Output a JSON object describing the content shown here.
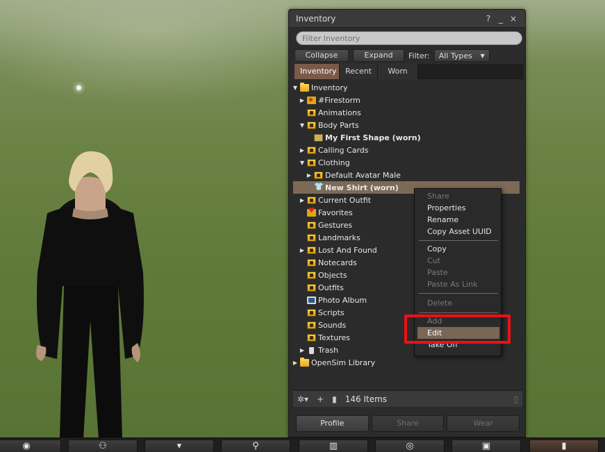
{
  "window": {
    "title": "Inventory",
    "help_label": "?",
    "minimize_label": "_",
    "close_label": "×"
  },
  "filter": {
    "placeholder": "Filter Inventory",
    "collapse_label": "Collapse",
    "expand_label": "Expand",
    "filter_label": "Filter:",
    "type_selected": "All Types"
  },
  "tabs": [
    {
      "label": "Inventory",
      "active": true
    },
    {
      "label": "Recent",
      "active": false
    },
    {
      "label": "Worn",
      "active": false
    }
  ],
  "tree": [
    {
      "label": "Inventory",
      "expanded": true,
      "icon": "folder-icon"
    },
    {
      "label": "#Firestorm",
      "expanded": false,
      "icon": "firestorm-folder-icon"
    },
    {
      "label": "Animations",
      "icon": "animations-folder-icon"
    },
    {
      "label": "Body Parts",
      "expanded": true,
      "icon": "body-parts-folder-icon"
    },
    {
      "label": "My First Shape (worn)",
      "icon": "shape-icon",
      "bold": true
    },
    {
      "label": "Calling Cards",
      "expanded": false,
      "icon": "calling-cards-folder-icon"
    },
    {
      "label": "Clothing",
      "expanded": true,
      "icon": "clothing-folder-icon"
    },
    {
      "label": "Default Avatar Male",
      "expanded": false,
      "icon": "clothing-folder-icon"
    },
    {
      "label": "New Shirt (worn)",
      "icon": "shirt-icon",
      "bold": true,
      "selected": true
    },
    {
      "label": "Current Outfit",
      "expanded": false,
      "icon": "current-outfit-folder-icon"
    },
    {
      "label": "Favorites",
      "icon": "favorites-folder-icon"
    },
    {
      "label": "Gestures",
      "icon": "gestures-folder-icon"
    },
    {
      "label": "Landmarks",
      "icon": "landmarks-folder-icon"
    },
    {
      "label": "Lost And Found",
      "expanded": false,
      "icon": "lost-and-found-folder-icon"
    },
    {
      "label": "Notecards",
      "icon": "notecards-folder-icon"
    },
    {
      "label": "Objects",
      "icon": "objects-folder-icon"
    },
    {
      "label": "Outfits",
      "icon": "outfits-folder-icon"
    },
    {
      "label": "Photo Album",
      "icon": "photo-album-folder-icon"
    },
    {
      "label": "Scripts",
      "icon": "scripts-folder-icon"
    },
    {
      "label": "Sounds",
      "icon": "sounds-folder-icon"
    },
    {
      "label": "Textures",
      "icon": "textures-folder-icon"
    },
    {
      "label": "Trash",
      "expanded": false,
      "icon": "trash-icon"
    },
    {
      "label": "OpenSim Library",
      "expanded": false,
      "icon": "folder-icon"
    }
  ],
  "context_menu": [
    {
      "label": "Share",
      "disabled": true
    },
    {
      "label": "Properties"
    },
    {
      "label": "Rename"
    },
    {
      "label": "Copy Asset UUID"
    },
    {
      "separator": true
    },
    {
      "label": "Copy"
    },
    {
      "label": "Cut",
      "disabled": true
    },
    {
      "label": "Paste",
      "disabled": true
    },
    {
      "label": "Paste As Link",
      "disabled": true
    },
    {
      "separator": true
    },
    {
      "label": "Delete",
      "disabled": true
    },
    {
      "separator": true
    },
    {
      "label": "Add",
      "disabled": true
    },
    {
      "label": "Edit",
      "hover": true
    },
    {
      "label": "Take Off"
    }
  ],
  "status": {
    "item_count": "146 Items"
  },
  "bottom_buttons": {
    "profile": "Profile",
    "share": "Share",
    "wear": "Wear"
  },
  "toolbar": [
    {
      "name": "toolbar-view-button",
      "icon": "eye-icon"
    },
    {
      "name": "toolbar-people-button",
      "icon": "people-icon"
    },
    {
      "name": "toolbar-appearance-button",
      "icon": "shirt-icon"
    },
    {
      "name": "toolbar-search-button",
      "icon": "search-icon"
    },
    {
      "name": "toolbar-map-button",
      "icon": "map-icon"
    },
    {
      "name": "toolbar-destinations-button",
      "icon": "destinations-icon"
    },
    {
      "name": "toolbar-snapshot-button",
      "icon": "camera-icon"
    },
    {
      "name": "toolbar-inventory-button",
      "icon": "inventory-icon",
      "active": true
    }
  ]
}
